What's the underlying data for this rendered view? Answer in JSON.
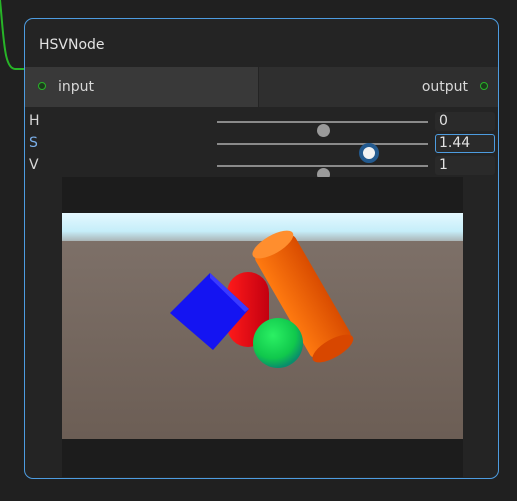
{
  "node": {
    "title": "HSVNode",
    "input_port": "input",
    "output_port": "output"
  },
  "params": [
    {
      "name": "H",
      "value": "0",
      "fraction": 0.5,
      "focused": false
    },
    {
      "name": "S",
      "value": "1.44",
      "fraction": 0.72,
      "focused": true
    },
    {
      "name": "V",
      "value": "1",
      "fraction": 0.5,
      "focused": false
    }
  ],
  "colors": {
    "node_border": "#4d9ce0",
    "port_green": "#27b427",
    "connection_wire": "#27b427",
    "sky": "#d9f6ff",
    "ground": "#6e6158",
    "cube": "#1818f0",
    "capsule": "#e00010",
    "cylinder": "#ff6a00",
    "sphere": "#10d050"
  },
  "preview": {
    "objects": [
      "cube-icon",
      "capsule-icon",
      "cylinder-icon",
      "sphere-icon"
    ]
  }
}
